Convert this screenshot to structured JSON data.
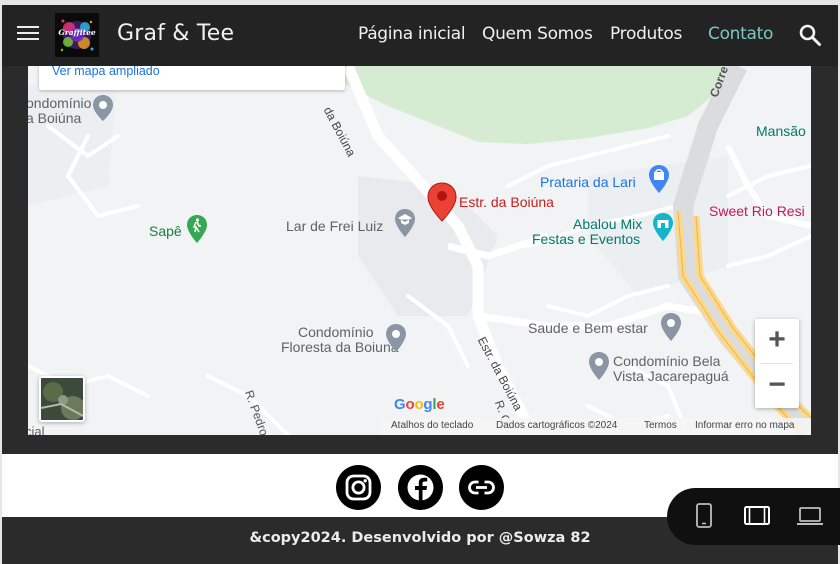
{
  "header": {
    "brand": "Graf & Tee",
    "logo_text": "Graffitee",
    "nav": [
      {
        "label": "Página inicial",
        "active": false
      },
      {
        "label": "Quem Somos",
        "active": false
      },
      {
        "label": "Produtos",
        "active": false
      },
      {
        "label": "Contato",
        "active": true
      }
    ],
    "icons": {
      "menu": "hamburger-icon",
      "search": "search-icon"
    }
  },
  "map": {
    "larger_map_link": "Ver mapa ampliado",
    "pin_label": "Estr. da Boiúna",
    "labels": {
      "condominio_boiuna_1": "ondomínio",
      "condominio_boiuna_2": "a Boiúna",
      "sape": "Sapê",
      "lar": "Lar de Frei Luiz",
      "prataria": "Prataria da Lari",
      "abalou_1": "Abalou Mix",
      "abalou_2": "Festas e Eventos",
      "sweet": "Sweet Rio Resi",
      "mansao": "Mansão",
      "saude": "Saude e Bem estar",
      "floresta_1": "Condomínio",
      "floresta_2": "Floresta da Boiuna",
      "bela_1": "Condomínio Bela",
      "bela_2": "Vista Jacarepaguá",
      "road_boiuna_top": "da Boiúna",
      "road_boiuna_bottom": "Estr. da Boiúna",
      "road_correia": "Corre",
      "road_pedro": "R. Pedro",
      "road_rc": "R. C",
      "cial": "cial"
    },
    "zoom_in": "+",
    "zoom_out": "−",
    "google_logo": "Google",
    "attribution": {
      "shortcuts": "Atalhos do teclado",
      "data": "Dados cartográficos ©2024",
      "terms": "Termos",
      "report": "Informar erro no mapa"
    },
    "colors": {
      "pin": "#ea4335",
      "water_green": "#d6ecd2",
      "road": "#ffffff",
      "highway": "#fdd987",
      "background": "#f1f3f4"
    }
  },
  "social": [
    {
      "name": "instagram",
      "icon": "instagram-icon"
    },
    {
      "name": "facebook",
      "icon": "facebook-icon"
    },
    {
      "name": "link",
      "icon": "link-icon"
    }
  ],
  "footer": {
    "text": "&copy2024. Desenvolvido por @Sowza 82"
  },
  "device_switcher": [
    {
      "name": "mobile",
      "icon": "phone-icon"
    },
    {
      "name": "tablet",
      "icon": "tablet-icon"
    },
    {
      "name": "desktop",
      "icon": "laptop-icon"
    }
  ]
}
